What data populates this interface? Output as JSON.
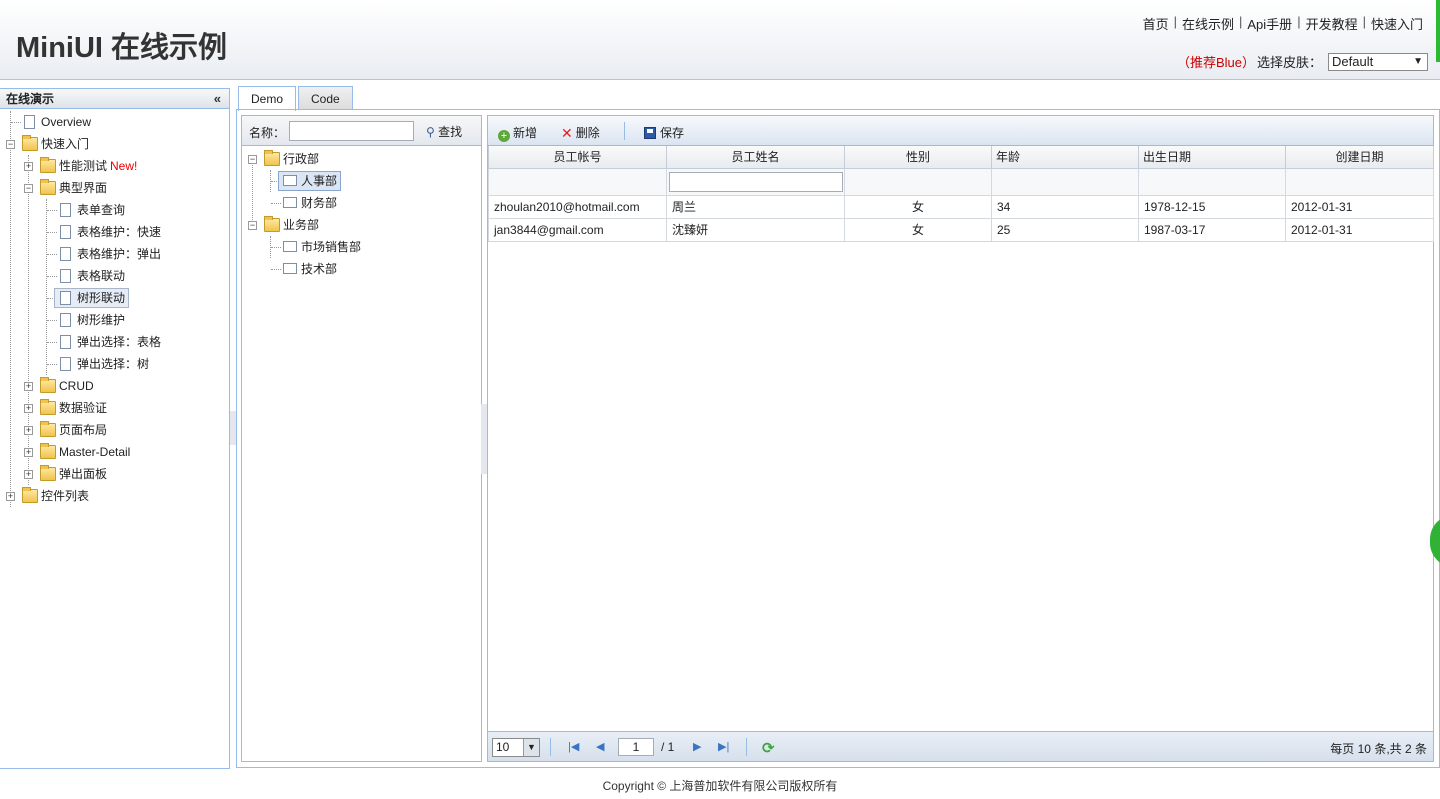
{
  "header": {
    "logo": "MiniUI 在线示例",
    "nav": [
      "首页",
      "在线示例",
      "Api手册",
      "开发教程",
      "快速入门"
    ],
    "recommend": "（推荐Blue）",
    "skin_label": "选择皮肤：",
    "skin_value": "Default"
  },
  "sidebar": {
    "title": "在线演示",
    "collapse": "«",
    "items": {
      "overview": "Overview",
      "quickstart": "快速入门",
      "perf": "性能测试",
      "perf_new": "New!",
      "typical": "典型界面",
      "t1": "表单查询",
      "t2": "表格维护：快速",
      "t3": "表格维护：弹出",
      "t4": "表格联动",
      "t5": "树形联动",
      "t6": "树形维护",
      "t7": "弹出选择：表格",
      "t8": "弹出选择：树",
      "crud": "CRUD",
      "validate": "数据验证",
      "layout": "页面布局",
      "masterdetail": "Master-Detail",
      "popup": "弹出面板",
      "controls": "控件列表"
    }
  },
  "tabs": {
    "demo": "Demo",
    "code": "Code"
  },
  "dept_tree": {
    "search_label": "名称：",
    "search_button": "查找",
    "nodes": {
      "admin": "行政部",
      "hr": "人事部",
      "finance": "财务部",
      "business": "业务部",
      "marketing": "市场销售部",
      "tech": "技术部"
    }
  },
  "toolbar": {
    "add": "新增",
    "delete": "删除",
    "save": "保存"
  },
  "grid": {
    "columns": [
      "员工帐号",
      "员工姓名",
      "性别",
      "年龄",
      "出生日期",
      "创建日期"
    ],
    "rows": [
      [
        "zhoulan2010@hotmail.com",
        "周兰",
        "女",
        "34",
        "1978-12-15",
        "2012-01-31"
      ],
      [
        "jan3844@gmail.com",
        "沈臻妍",
        "女",
        "25",
        "1987-03-17",
        "2012-01-31"
      ]
    ]
  },
  "pager": {
    "page_size": "10",
    "page": "1",
    "of": "/ 1",
    "info": "每页 10 条,共 2 条"
  },
  "footer": "Copyright © 上海普加软件有限公司版权所有"
}
